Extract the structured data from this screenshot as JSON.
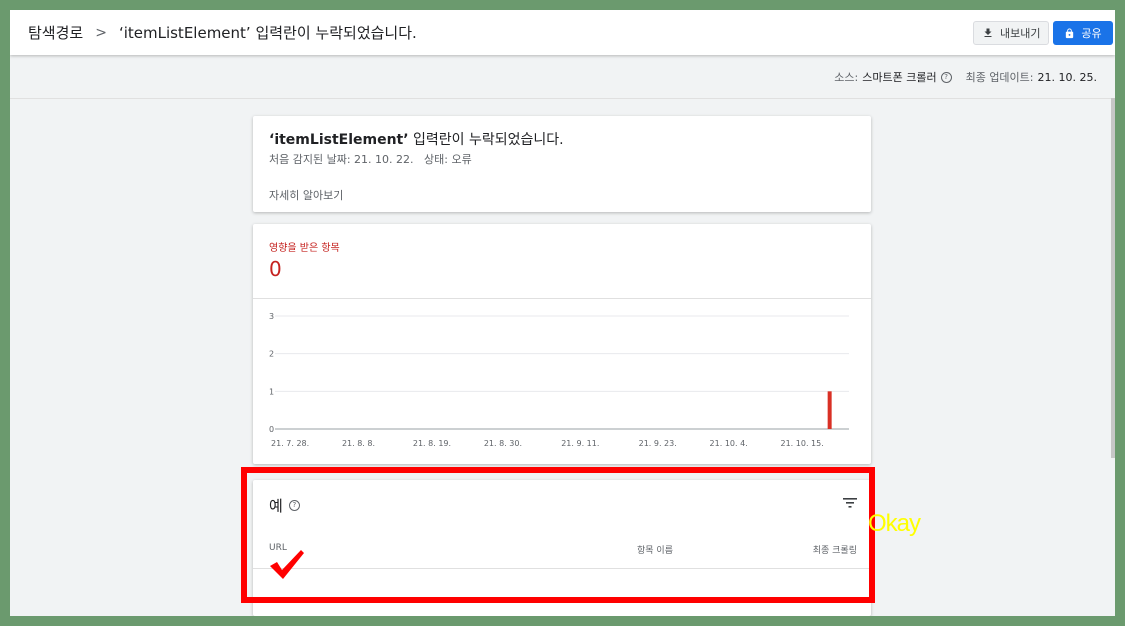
{
  "header": {
    "breadcrumb_root": "탐색경로",
    "breadcrumb_separator": ">",
    "breadcrumb_current": "‘itemListElement’ 입력란이 누락되었습니다.",
    "export_label": "내보내기",
    "share_label": "공유"
  },
  "info": {
    "source_label": "소스:",
    "source_value": "스마트폰 크롤러",
    "updated_label": "최종 업데이트:",
    "updated_value": "21. 10. 25."
  },
  "issue": {
    "title_field": "‘itemListElement’",
    "title_rest": " 입력란이 누락되었습니다.",
    "first_detected_label": "처음 감지된 날짜:",
    "first_detected_value": "21. 10. 22.",
    "status_label": "상태:",
    "status_value": "오류",
    "learn_more": "자세히 알아보기"
  },
  "affected": {
    "label": "영향을 받은 항목",
    "count": "0"
  },
  "chart_data": {
    "type": "bar",
    "x": [
      "21. 7. 28.",
      "21. 8. 8.",
      "21. 8. 19.",
      "21. 8. 30.",
      "21. 9. 11.",
      "21. 9. 23.",
      "21. 10. 4.",
      "21. 10. 15."
    ],
    "yticks": [
      "0",
      "1",
      "2",
      "3"
    ],
    "ylim": [
      0,
      3
    ],
    "bars": [
      {
        "date": "21. 10. 22.",
        "value": 1
      }
    ],
    "bar_color": "#d93025",
    "grid": true
  },
  "examples": {
    "title": "예",
    "col_url": "URL",
    "col_item_name": "항목 이름",
    "col_last_crawled": "최종 크롤링"
  },
  "annotation": {
    "okay_text": "Okay",
    "box_color": "#ff0000",
    "check_color": "#ff0000",
    "okay_color": "#ffff00"
  }
}
